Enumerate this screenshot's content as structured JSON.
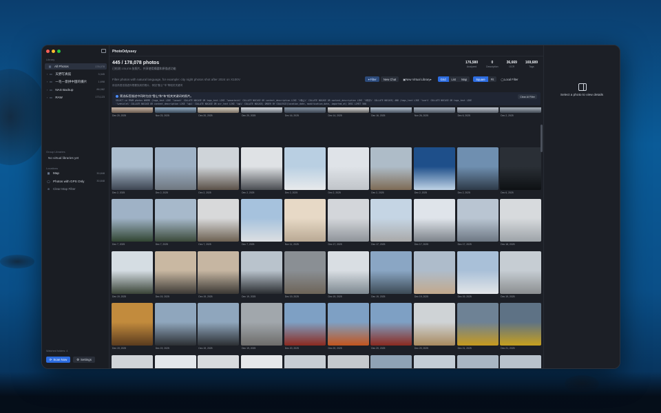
{
  "app": {
    "title": "PhotoOdyssey"
  },
  "sidebar": {
    "library_label": "Library",
    "library_items": [
      {
        "label": "All Photos",
        "count": "178,078",
        "active": true,
        "icon": "photo-stack-icon"
      },
      {
        "label": "天野写真館",
        "count": "3,345",
        "icon": "folder-icon"
      },
      {
        "label": "一毛一意拼中国的摄片",
        "count": "1,698",
        "icon": "folder-icon"
      },
      {
        "label": "NAS Backup",
        "count": "86,082",
        "icon": "folder-icon"
      },
      {
        "label": "RAW",
        "count": "173,123",
        "icon": "folder-icon"
      }
    ],
    "group_label": "Group Libraries",
    "group_empty": "No virtual libraries yet",
    "locations_label": "Locations",
    "location_items": [
      {
        "label": "Map",
        "count": "30,848",
        "icon": "map-icon"
      },
      {
        "label": "Photos with GPS Only",
        "count": "30,848",
        "icon": "radio-icon"
      },
      {
        "label": "Clear Map Filter",
        "icon": "clear-icon"
      }
    ],
    "watched_label": "Watched folders: 4",
    "scan_label": "Scan Now",
    "settings_label": "Settings"
  },
  "header": {
    "title": "445 / 178,078 photos",
    "subtitle": "已检测 178,078 张照片，共享使用摘要和原描述功能",
    "stats": [
      {
        "value": "176,580",
        "label": "Analyzed"
      },
      {
        "value": "0",
        "label": "Description"
      },
      {
        "value": "36,669",
        "label": "OCR"
      },
      {
        "value": "169,689",
        "label": "Tags"
      }
    ]
  },
  "search": {
    "placeholder": "Filter photos with natural language, for example: city night photos shot after 2024 on X100V",
    "hint": "用自然语言描述你想要找到的照片，例如\"雪山\"\"车\"等相关关键词",
    "buttons": {
      "filter": "Filter",
      "new_chat": "New Chat",
      "new_virtual_library": "New Virtual Library",
      "grid": "Grid",
      "list": "List",
      "map": "Map",
      "square": "Square",
      "fit": "Fit",
      "local_filter": "Local Filter"
    }
  },
  "ai_filter": {
    "title": "筛选标签描述中同时包含\"雪山\"和\"车\"相关关键词的照片。",
    "sql_line1": "SELECT id FROM photos WHERE (tags_text LIKE '%snow%' COLLATE NOCASE OR tags_text LIKE '%mountain%' COLLATE NOCASE OR content_description LIKE '%雪山%' COLLATE NOCASE OR content_description LIKE '%雪景%' COLLATE NOCASE) AND (tags_text LIKE '%car%' COLLATE NOCASE OR tags_text LIKE",
    "sql_line2": "'%vehicle%' COLLATE NOCASE OR content_description LIKE '%车%' COLLATE NOCASE OR ocr_text LIKE '%车%' COLLATE NOCASE) ORDER BY COALESCE(location_date, modification_date, imported_at) DESC LIMIT 500",
    "clear_label": "Clear AI Filter"
  },
  "grid": {
    "rows": [
      {
        "dates": [
          "Dec 20, 2025",
          "Nov 23, 2025",
          "Dec 20, 2025",
          "Dec 20, 2025",
          "Dec 16, 2025",
          "Dec 14, 2025",
          "Dec 16, 2025",
          "Nov 26, 2025",
          "Dec 6, 2025",
          "Dec 2, 2025"
        ],
        "colors": [
          [
            "#b9a89a",
            "#6a5a4e"
          ],
          [
            "#8aa0b5",
            "#3a4a5a"
          ],
          [
            "#c9c2b5",
            "#7b7064"
          ],
          [
            "#c8ccd2",
            "#5e646d"
          ],
          [
            "#7e8b99",
            "#3a4350"
          ],
          [
            "#cfcfcf",
            "#5a5a5a"
          ],
          [
            "#a9b5c3",
            "#454f5c"
          ],
          [
            "#9ca6b3",
            "#4a525c"
          ],
          [
            "#b3b9c2",
            "#555c66"
          ],
          [
            "#9aa3ad",
            "#404852"
          ]
        ]
      },
      {
        "dates": [
          "Dec 2, 2025",
          "Dec 2, 2025",
          "Dec 2, 2025",
          "Dec 2, 2025",
          "Dec 2, 2025",
          "Dec 2, 2025",
          "Dec 2, 2025",
          "Dec 2, 2025",
          "Dec 2, 2025",
          "Dec 6, 2025"
        ],
        "colors": [
          [
            "#aabccd",
            "#3d4552"
          ],
          [
            "#9fb2c6",
            "#6f7780"
          ],
          [
            "#cfd4d9",
            "#5b5148"
          ],
          [
            "#dfe2e5",
            "#4a4d52"
          ],
          [
            "#b9cfe2",
            "#e8eaec"
          ],
          [
            "#dfe3e8",
            "#c0c4c9"
          ],
          [
            "#aebcc8",
            "#7e6b55"
          ],
          [
            "#1e4f8a",
            "#bfd3e6"
          ],
          [
            "#6f8fb0",
            "#2e3a48"
          ],
          [
            "#2a2f36",
            "#0e1114"
          ]
        ]
      },
      {
        "dates": [
          "Dec 7, 2025",
          "Dec 7, 2025",
          "Dec 7, 2025",
          "Dec 7, 2025",
          "Nov 11, 2025",
          "Dec 17, 2025",
          "Dec 17, 2025",
          "Dec 17, 2025",
          "Dec 17, 2025",
          "Dec 18, 2025"
        ],
        "colors": [
          [
            "#9fb2c6",
            "#314532"
          ],
          [
            "#a7b9cb",
            "#3b4a3a"
          ],
          [
            "#d8d9da",
            "#6d6152"
          ],
          [
            "#a6c2dd",
            "#dcdfe2"
          ],
          [
            "#e7d9c6",
            "#b9a994"
          ],
          [
            "#d3d6da",
            "#8f949a"
          ],
          [
            "#c5d5e4",
            "#a9a9a9"
          ],
          [
            "#dfe4ea",
            "#7d838a"
          ],
          [
            "#b9c5d2",
            "#6e7884"
          ],
          [
            "#d7dadd",
            "#9da3a8"
          ]
        ]
      },
      {
        "dates": [
          "Dec 19, 2025",
          "Dec 19, 2025",
          "Dec 19, 2025",
          "Dec 19, 2025",
          "Dec 19, 2025",
          "Dec 19, 2025",
          "Dec 19, 2025",
          "Dec 19, 2025",
          "Dec 19, 2025",
          "Dec 19, 2025"
        ],
        "colors": [
          [
            "#d5dde3",
            "#3a4438"
          ],
          [
            "#c9b8a2",
            "#3d3a36"
          ],
          [
            "#c6b6a2",
            "#3b3834"
          ],
          [
            "#b9c3cc",
            "#2a2d31"
          ],
          [
            "#8a8f94",
            "#6d6458"
          ],
          [
            "#d9dee3",
            "#7d8890"
          ],
          [
            "#8aa6c4",
            "#3c4a55"
          ],
          [
            "#aebccb",
            "#c2a98c"
          ],
          [
            "#a9c0d8",
            "#e2e5e8"
          ],
          [
            "#c6cdd3",
            "#8b8e90"
          ]
        ]
      },
      {
        "dates": [
          "Dec 19, 2025",
          "Dec 19, 2025",
          "Dec 19, 2025",
          "Dec 19, 2025",
          "Dec 20, 2025",
          "Dec 20, 2025",
          "Dec 20, 2025",
          "Dec 20, 2025",
          "Dec 21, 2025",
          "Dec 21, 2025"
        ],
        "colors": [
          [
            "#c28b3d",
            "#5a3b1e"
          ],
          [
            "#8fa6bd",
            "#2c2f33"
          ],
          [
            "#8fa6bd",
            "#2c2f33"
          ],
          [
            "#a1a7ac",
            "#6d6c6a"
          ],
          [
            "#7ea0c4",
            "#8b2a20"
          ],
          [
            "#7ea0c4",
            "#c2551e"
          ],
          [
            "#7ea0c4",
            "#8b2a20"
          ],
          [
            "#cfd3d6",
            "#a88a5f"
          ],
          [
            "#6e8295",
            "#c79a1e"
          ],
          [
            "#5e7285",
            "#c7a01e"
          ]
        ]
      },
      {
        "dates": [
          "",
          "",
          "",
          "",
          "",
          "",
          "",
          "",
          "",
          ""
        ],
        "colors": [
          [
            "#d0d4d8",
            "#9a8e80"
          ],
          [
            "#e3e7eb",
            "#8c949c"
          ],
          [
            "#d7dadd",
            "#7d6f60"
          ],
          [
            "#e6e8ea",
            "#6f7378"
          ],
          [
            "#c7cdd3",
            "#2e3134"
          ],
          [
            "#c5c9cd",
            "#8c6a55"
          ],
          [
            "#8fa3b5",
            "#c7d2dc"
          ],
          [
            "#c3cdd6",
            "#4a4e52"
          ],
          [
            "#a9b6c3",
            "#8c8778"
          ],
          [
            "#b8c2cc",
            "#6a6d6f"
          ]
        ]
      }
    ]
  },
  "detail": {
    "placeholder": "Select a photo to view details"
  }
}
